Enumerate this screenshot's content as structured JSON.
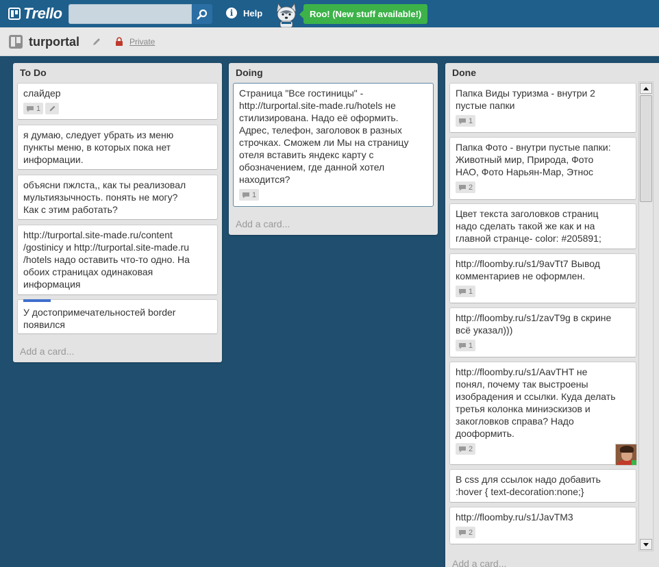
{
  "header": {
    "logo_text": "Trello",
    "search": {
      "value": "",
      "placeholder": ""
    },
    "help_label": "Help",
    "roo_label": "Roo! (New stuff available!)"
  },
  "board": {
    "title": "turportal",
    "visibility": "Private"
  },
  "lists": [
    {
      "title": "To Do",
      "add_card": "Add a card...",
      "cards": [
        {
          "text": "слайдер",
          "comments": "1"
        },
        {
          "text": "я думаю, следует убрать из меню\nпункты меню, в которых пока нет\nинформации."
        },
        {
          "text": "объясни пжлста,, как ты реализовал\nмультиязычность. понять не могу?\nКак с этим работать?"
        },
        {
          "text": "http://turportal.site-made.ru/content\n/gostinicy и http://turportal.site-made.ru\n/hotels надо оставить что-то одно. На\nобоих страницах одинаковая\nинформация"
        },
        {
          "text": "У достопримечательностей border\nпоявился"
        }
      ]
    },
    {
      "title": "Doing",
      "add_card": "Add a card...",
      "cards": [
        {
          "text": "Страница \"Все гостиницы\" -\nhttp://turportal.site-made.ru/hotels не\nстилизирована. Надо её оформить.\nАдрес, телефон, заголовок в разных\nстрочках. Сможем ли Мы на страницу\nотеля вставить яндекс карту с\nобозначением, где данной хотел\nнаходится?",
          "comments": "1"
        }
      ]
    },
    {
      "title": "Done",
      "add_card": "Add a card...",
      "cards": [
        {
          "text": "Папка Виды туризма - внутри 2\nпустые папки",
          "comments": "1"
        },
        {
          "text": "Папка Фото - внутри пустые папки:\nЖивотный мир, Природа, Фото\nНАО, Фото Нарьян-Мар, Этнос",
          "comments": "2"
        },
        {
          "text": "Цвет текста заголовков страниц\nнадо сделать такой же как и на\nглавной странце- color: #205891;"
        },
        {
          "text": "http://floomby.ru/s1/9avTt7 Вывод\nкомментариев не оформлен.",
          "comments": "1"
        },
        {
          "text": "http://floomby.ru/s1/zavT9g в скрине\nвсё указал)))",
          "comments": "1"
        },
        {
          "text": "http://floomby.ru/s1/AavTHT не\nпонял, почему так выстроены\nизобрадения и ссылки. Куда делать\nтретья колонка миниэскизов и\nзакогловков справа? Надо\nдооформить.",
          "comments": "2"
        },
        {
          "text": "В css для ссылок надо добавить\n:hover { text-decoration:none;}"
        },
        {
          "text": "http://floomby.ru/s1/JavTM3",
          "comments": "2"
        }
      ]
    }
  ],
  "colors": {
    "topbar": "#1e5f8c",
    "board_bg": "#1f4e6e",
    "roo_green": "#3cb249",
    "label_blue": "#3e6fcb"
  }
}
